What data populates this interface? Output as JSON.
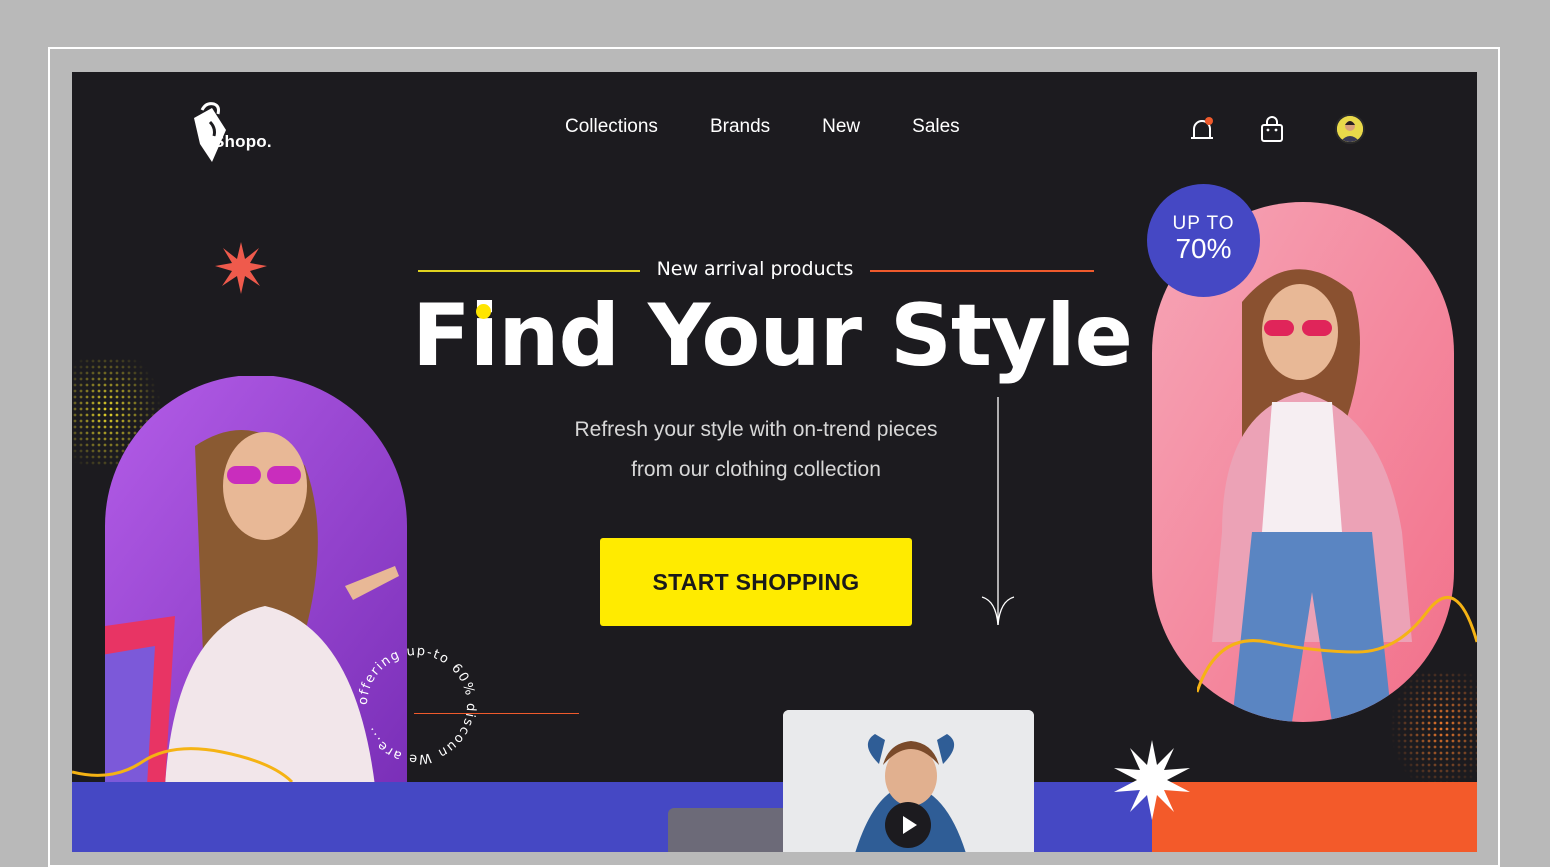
{
  "brand": {
    "name": "Shopo."
  },
  "nav": {
    "items": [
      {
        "label": "Collections"
      },
      {
        "label": "Brands"
      },
      {
        "label": "New"
      },
      {
        "label": "Sales"
      }
    ]
  },
  "header_icons": [
    "bell-icon",
    "shopping-bag-icon",
    "user-avatar"
  ],
  "hero": {
    "eyebrow": "New arrival products",
    "title": "Find Your Style",
    "subtitle_line1": "Refresh your style with on-trend pieces",
    "subtitle_line2": "from our clothing collection",
    "cta_label": "START SHOPPING"
  },
  "badge": {
    "top": "UP TO",
    "value": "70%"
  },
  "circular_text": "offering up-to 60% discoun We are...",
  "colors": {
    "background": "#1c1b1f",
    "accent_yellow": "#ffeb00",
    "accent_orange": "#f35a2a",
    "accent_blue": "#4548c4",
    "accent_red_star": "#ef5a4c",
    "left_photo_bg": "#9b4fd6",
    "right_photo_bg": "#f27d92"
  }
}
